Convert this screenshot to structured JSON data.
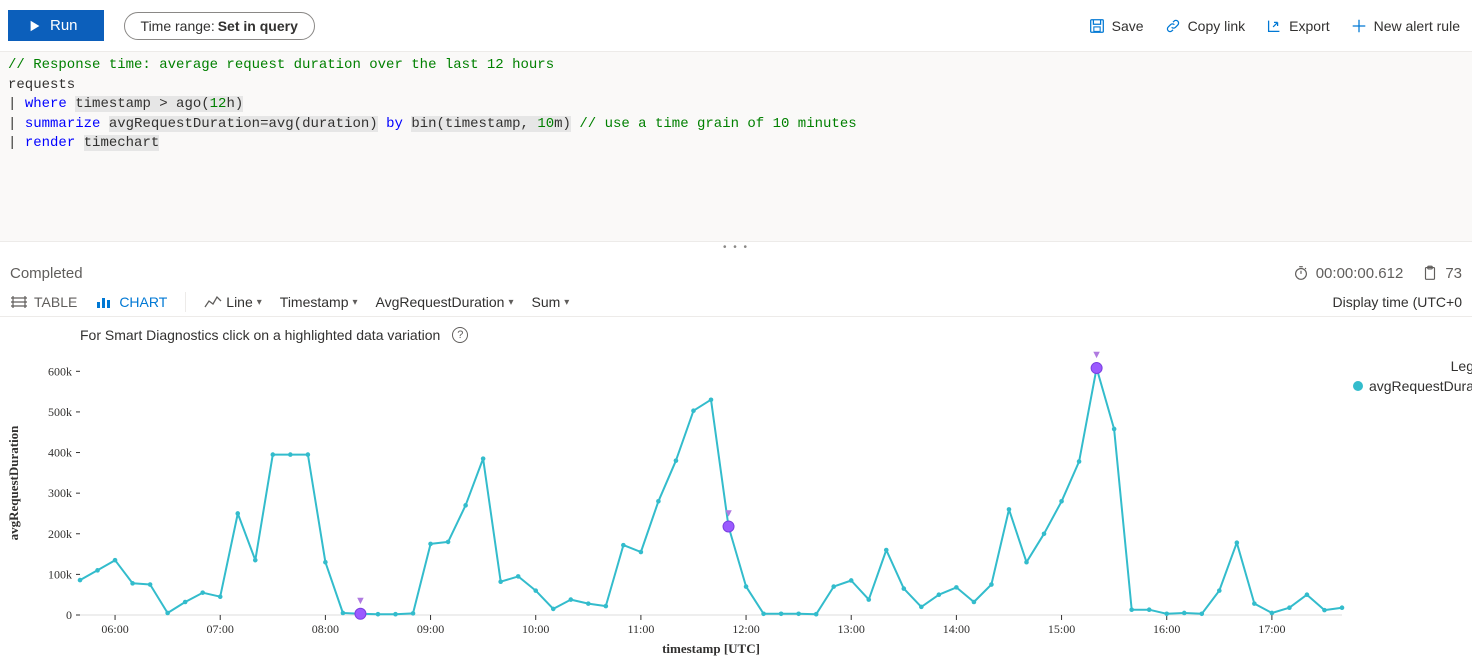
{
  "toolbar": {
    "run_label": "Run",
    "time_range_label": "Time range:",
    "time_range_value": "Set in query",
    "actions": {
      "save": "Save",
      "copy_link": "Copy link",
      "export": "Export",
      "new_alert_rule": "New alert rule"
    }
  },
  "editor": {
    "comment_top": "// Response time: average request duration over the last 12 hours",
    "line2": "requests",
    "kw_where": "where",
    "l3_rest": "timestamp > ago(",
    "l3_num": "12",
    "l3_after": "h)",
    "kw_summarize": "summarize",
    "l4_rest": "avgRequestDuration=avg(duration)",
    "kw_by": "by",
    "l4_bin": "bin(timestamp, ",
    "l4_num": "10",
    "l4_after": "m)",
    "l4_comment": "// use a time grain of 10 minutes",
    "kw_render": "render",
    "l5_rest": "timechart"
  },
  "status": {
    "state": "Completed",
    "duration": "00:00:00.612",
    "rows": "73"
  },
  "viewbar": {
    "table_label": "TABLE",
    "chart_label": "CHART",
    "line_dd": "Line",
    "ts_dd": "Timestamp",
    "val_dd": "AvgRequestDuration",
    "agg_dd": "Sum",
    "display_time": "Display time (UTC+0"
  },
  "chart_header": {
    "hint": "For Smart Diagnostics click on a highlighted data variation"
  },
  "legend": {
    "title": "Leg",
    "series": "avgRequestDura"
  },
  "chart_data": {
    "type": "line",
    "title": "",
    "xlabel": "timestamp [UTC]",
    "ylabel": "avgRequestDuration",
    "ylim": [
      0,
      650000
    ],
    "x_ticks": [
      "06:00",
      "07:00",
      "08:00",
      "09:00",
      "10:00",
      "11:00",
      "12:00",
      "13:00",
      "14:00",
      "15:00",
      "16:00",
      "17:00"
    ],
    "y_ticks": [
      0,
      100000,
      200000,
      300000,
      400000,
      500000,
      600000
    ],
    "y_tick_labels": [
      "0",
      "100k",
      "200k",
      "300k",
      "400k",
      "500k",
      "600k"
    ],
    "highlight_indices": [
      16,
      37,
      58
    ],
    "series": [
      {
        "name": "avgRequestDuration",
        "color": "#33bccc",
        "x": [
          "05:40",
          "05:50",
          "06:00",
          "06:10",
          "06:20",
          "06:30",
          "06:40",
          "06:50",
          "07:00",
          "07:10",
          "07:20",
          "07:30",
          "07:40",
          "07:50",
          "08:00",
          "08:10",
          "08:20",
          "08:30",
          "08:40",
          "08:50",
          "09:00",
          "09:10",
          "09:20",
          "09:30",
          "09:40",
          "09:50",
          "10:00",
          "10:10",
          "10:20",
          "10:30",
          "10:40",
          "10:50",
          "11:00",
          "11:10",
          "11:20",
          "11:30",
          "11:40",
          "11:50",
          "12:00",
          "12:10",
          "12:20",
          "12:30",
          "12:40",
          "12:50",
          "13:00",
          "13:10",
          "13:20",
          "13:30",
          "13:40",
          "13:50",
          "14:00",
          "14:10",
          "14:20",
          "14:30",
          "14:40",
          "14:50",
          "15:00",
          "15:10",
          "15:20",
          "15:30",
          "15:40",
          "15:50",
          "16:00",
          "16:10",
          "16:20",
          "16:30",
          "16:40",
          "16:50",
          "17:00",
          "17:10",
          "17:20",
          "17:30",
          "17:40"
        ],
        "values": [
          86000,
          110000,
          135000,
          78000,
          75000,
          5000,
          32000,
          55000,
          45000,
          250000,
          135000,
          395000,
          395000,
          395000,
          130000,
          5000,
          3000,
          2000,
          2000,
          4000,
          175000,
          180000,
          270000,
          385000,
          82000,
          95000,
          60000,
          15000,
          38000,
          28000,
          22000,
          172000,
          155000,
          280000,
          380000,
          503000,
          530000,
          218000,
          70000,
          3000,
          3000,
          3000,
          2000,
          70000,
          85000,
          38000,
          160000,
          65000,
          20000,
          50000,
          68000,
          32000,
          75000,
          260000,
          130000,
          200000,
          280000,
          378000,
          608000,
          458000,
          13000,
          13000,
          3000,
          5000,
          3000,
          60000,
          178000,
          28000,
          5000,
          18000,
          50000,
          12000,
          18000
        ]
      }
    ]
  }
}
